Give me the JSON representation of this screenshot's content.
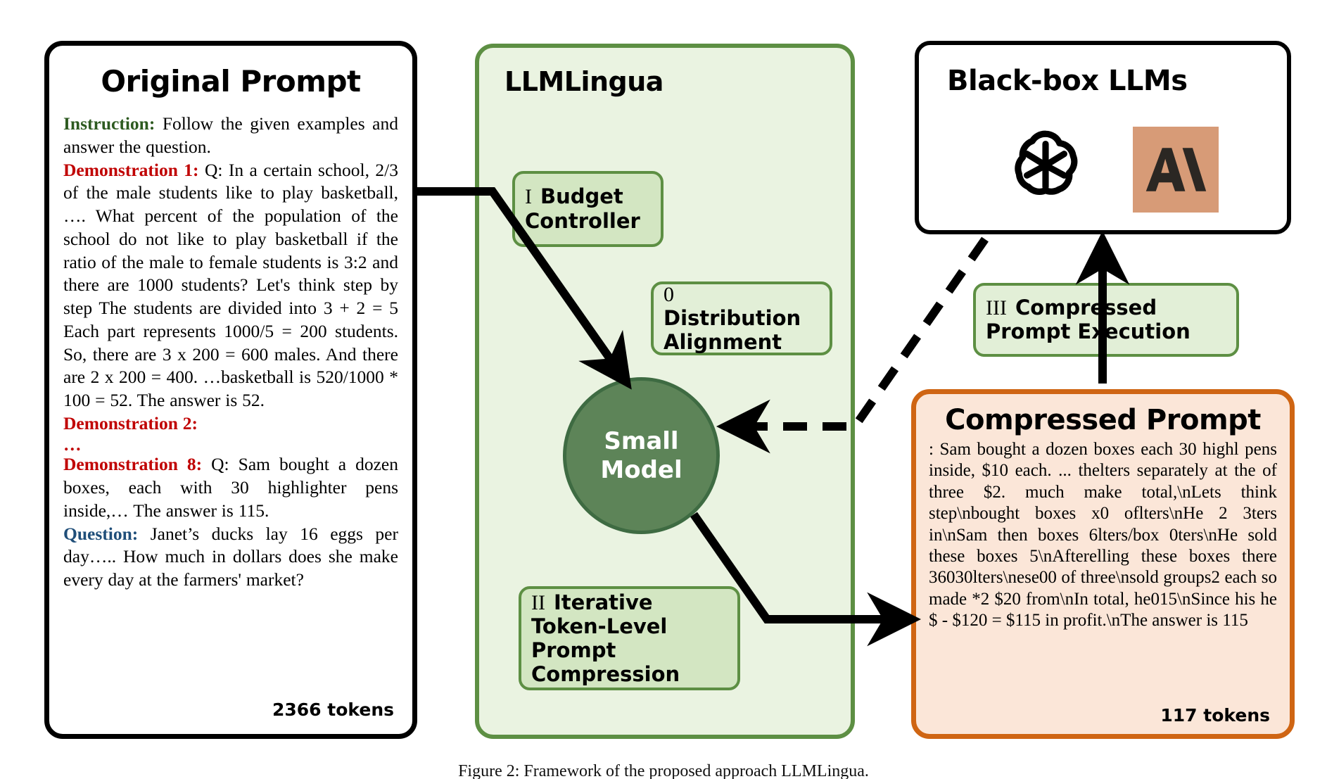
{
  "figure": {
    "caption": "Figure 2: Framework of the proposed approach LLMLingua."
  },
  "original_prompt": {
    "title": "Original Prompt",
    "instruction_label": "Instruction:",
    "instruction_text": " Follow the given examples and answer the question.",
    "demo1_label": "Demonstration 1:",
    "demo1_text": " Q: In a certain school, 2/3 of the male students like to play basketball, …. What percent of the population of the school do not like to play basketball if the ratio of the male to female students is 3:2 and there are 1000 students? Let's think step by step The students are divided into 3 + 2 = 5 Each part represents 1000/5 = 200 students. So, there are 3 x 200 = 600 males. And there are 2 x 200 = 400. …basketball is 520/1000 * 100 = 52. The answer is 52.",
    "demo2_label": "Demonstration 2:",
    "ellipsis": "…",
    "demo8_label": "Demonstration 8:",
    "demo8_text": " Q: Sam bought a dozen boxes, each with 30 highlighter pens inside,… The answer is 115.",
    "question_label": "Question:",
    "question_text": " Janet’s ducks lay 16 eggs per day….. How much in dollars does she make every day at the farmers' market?",
    "token_count": "2366 tokens"
  },
  "llmlingua": {
    "title": "LLMLingua",
    "steps": [
      {
        "numeral": "I",
        "label": "Budget Controller"
      },
      {
        "numeral": "0",
        "label": "Distribution Alignment"
      },
      {
        "numeral": "II",
        "label": "Iterative Token-Level Prompt Compression"
      }
    ],
    "small_model": {
      "line1": "Small",
      "line2": "Model"
    }
  },
  "black_box_llms": {
    "title": "Black-box LLMs",
    "logos": [
      {
        "name": "openai-logo",
        "alt": "OpenAI"
      },
      {
        "name": "anthropic-logo",
        "alt": "Anthropic",
        "mark": "A\\",
        "bg": "#d79b77"
      }
    ]
  },
  "execution": {
    "numeral": "III",
    "label": "Compressed Prompt Execution"
  },
  "compressed_prompt": {
    "title": "Compressed Prompt",
    "text": ": Sam bought a dozen boxes each 30 highl pens inside, $10 each. ... thelters separately at the of three $2. much make total,\\nLets think step\\nbought boxes x0 oflters\\nHe 2 3ters in\\nSam then boxes 6lters/box 0ters\\nHe sold these boxes 5\\nAfterelling these boxes there 36030lters\\nese00 of three\\nsold groups2 each so made *2 $20 from\\nIn total, he015\\nSince his he $ - $120 = $115 in profit.\\nThe answer is 115",
    "token_count": "117 tokens"
  },
  "colors": {
    "green_border": "#5d8f43",
    "green_panel_bg": "#eaf3e1",
    "green_box_bg": "#d3e6c2",
    "small_model_fill": "#5d8458",
    "orange_border": "#cf6513",
    "orange_panel_bg": "#fbe6d8",
    "instruction_green": "#2d5a20",
    "demo_red": "#c00000",
    "question_blue": "#1f4e79",
    "anthropic_tan": "#d79b77"
  }
}
